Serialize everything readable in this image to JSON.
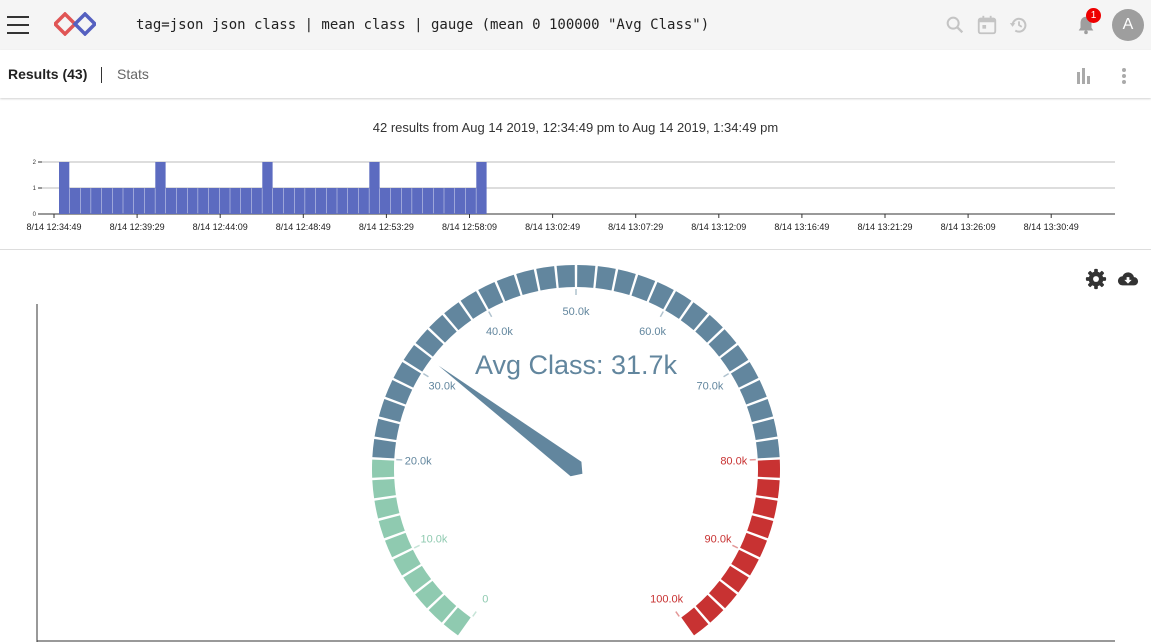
{
  "header": {
    "query": "tag=json json class | mean class | gauge (mean 0 100000 \"Avg Class\")",
    "notification_count": "1",
    "avatar_initial": "A",
    "icons": [
      "menu-icon",
      "logo-icon",
      "search-icon",
      "calendar-icon",
      "history-icon",
      "bell-icon"
    ]
  },
  "tabs": {
    "results_label": "Results (43)",
    "stats_label": "Stats"
  },
  "summary": "42 results from Aug 14 2019, 12:34:49 pm to Aug 14 2019, 1:34:49 pm",
  "histogram": {
    "type": "bar",
    "ylim": [
      0,
      2
    ],
    "yticks": [
      "0",
      "1",
      "2"
    ],
    "xticks": [
      "8/14 12:34:49",
      "8/14 12:39:29",
      "8/14 12:44:09",
      "8/14 12:48:49",
      "8/14 12:53:29",
      "8/14 12:58:09",
      "8/14 13:02:49",
      "8/14 13:07:29",
      "8/14 13:12:09",
      "8/14 13:16:49",
      "8/14 13:21:29",
      "8/14 13:26:09",
      "8/14 13:30:49"
    ],
    "values": [
      2,
      1,
      1,
      1,
      1,
      1,
      1,
      1,
      1,
      2,
      1,
      1,
      1,
      1,
      1,
      1,
      1,
      1,
      1,
      2,
      1,
      1,
      1,
      1,
      1,
      1,
      1,
      1,
      1,
      2,
      1,
      1,
      1,
      1,
      1,
      1,
      1,
      1,
      1,
      2
    ],
    "color": "#5c6bc0"
  },
  "chart_data": {
    "type": "gauge",
    "title": "Avg Class: 31.7k",
    "value": 31700,
    "min": 0,
    "max": 100000,
    "tick_labels": [
      "0",
      "10.0k",
      "20.0k",
      "30.0k",
      "40.0k",
      "50.0k",
      "60.0k",
      "70.0k",
      "80.0k",
      "90.0k",
      "100.0k"
    ],
    "bands": [
      {
        "from": 0,
        "to": 20000,
        "color": "#8fcab0"
      },
      {
        "from": 20000,
        "to": 80000,
        "color": "#62869e"
      },
      {
        "from": 80000,
        "to": 100000,
        "color": "#c83232"
      }
    ]
  },
  "actions": {
    "icons": [
      "settings-icon",
      "cloud-download-icon"
    ]
  }
}
